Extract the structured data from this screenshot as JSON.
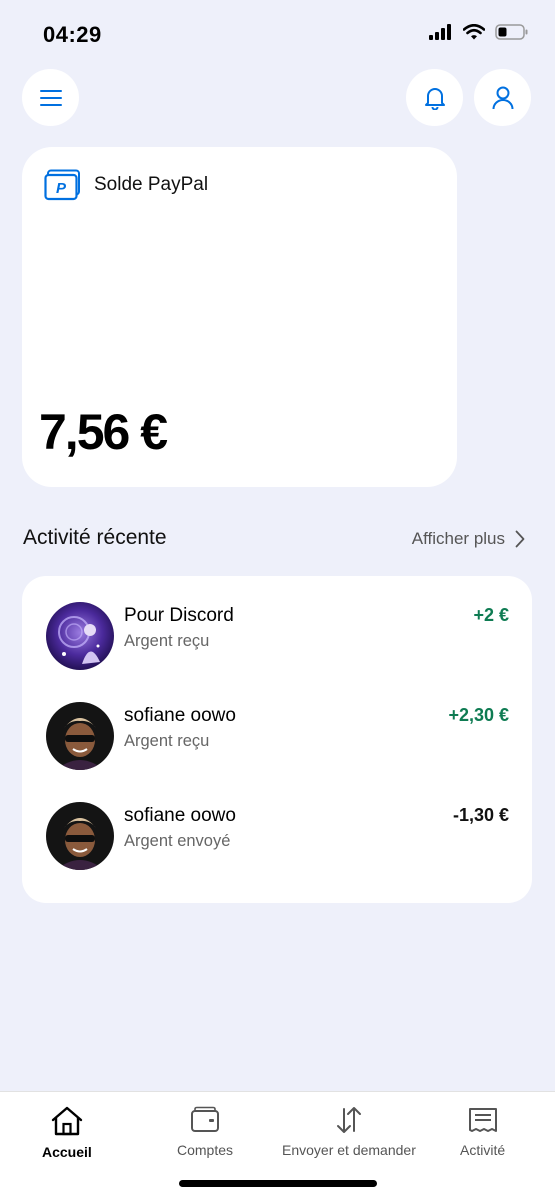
{
  "status_bar": {
    "time": "04:29"
  },
  "balance": {
    "label": "Solde PayPal",
    "amount": "7,56 €"
  },
  "recent_activity": {
    "title": "Activité récente",
    "see_more": "Afficher plus",
    "items": [
      {
        "name": "Pour Discord",
        "subtitle": "Argent reçu",
        "amount": "+2 €",
        "positive": true
      },
      {
        "name": "sofiane oowo",
        "subtitle": "Argent reçu",
        "amount": "+2,30 €",
        "positive": true
      },
      {
        "name": "sofiane oowo",
        "subtitle": "Argent envoyé",
        "amount": "-1,30 €",
        "positive": false
      }
    ]
  },
  "bottom_nav": {
    "items": [
      {
        "label": "Accueil",
        "icon": "home-icon",
        "active": true
      },
      {
        "label": "Comptes",
        "icon": "wallet-icon",
        "active": false
      },
      {
        "label": "Envoyer et demander",
        "icon": "transfer-icon",
        "active": false
      },
      {
        "label": "Activité",
        "icon": "receipt-icon",
        "active": false
      }
    ]
  },
  "colors": {
    "accent": "#0070e0",
    "positive": "#0e7b52",
    "background": "#eef0fa"
  }
}
